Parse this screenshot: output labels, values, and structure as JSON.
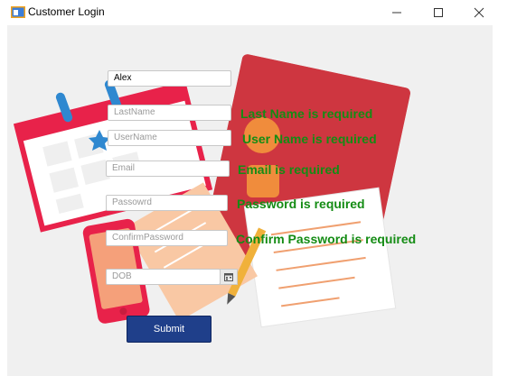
{
  "window": {
    "title": "Customer Login",
    "controls": [
      "minimize",
      "maximize",
      "close"
    ]
  },
  "form": {
    "first_name": {
      "value": "Alex"
    },
    "last_name": {
      "placeholder": "LastName",
      "error": "Last Name is required"
    },
    "user_name": {
      "placeholder": "UserName",
      "error": "User Name is required"
    },
    "email": {
      "placeholder": "Email",
      "error": "Email is required"
    },
    "password": {
      "placeholder": "Passowrd",
      "error": "Password is required"
    },
    "confirm_password": {
      "placeholder": "ConfirmPassword",
      "error": "Confirm Password is required"
    },
    "dob": {
      "placeholder": "DOB",
      "icon": "calendar-icon"
    },
    "submit_label": "Submit"
  },
  "colors": {
    "error_text": "#148c14",
    "submit_bg": "#1f3f8a",
    "illustration_red": "#e8224a",
    "illustration_orange": "#f08c3c"
  }
}
